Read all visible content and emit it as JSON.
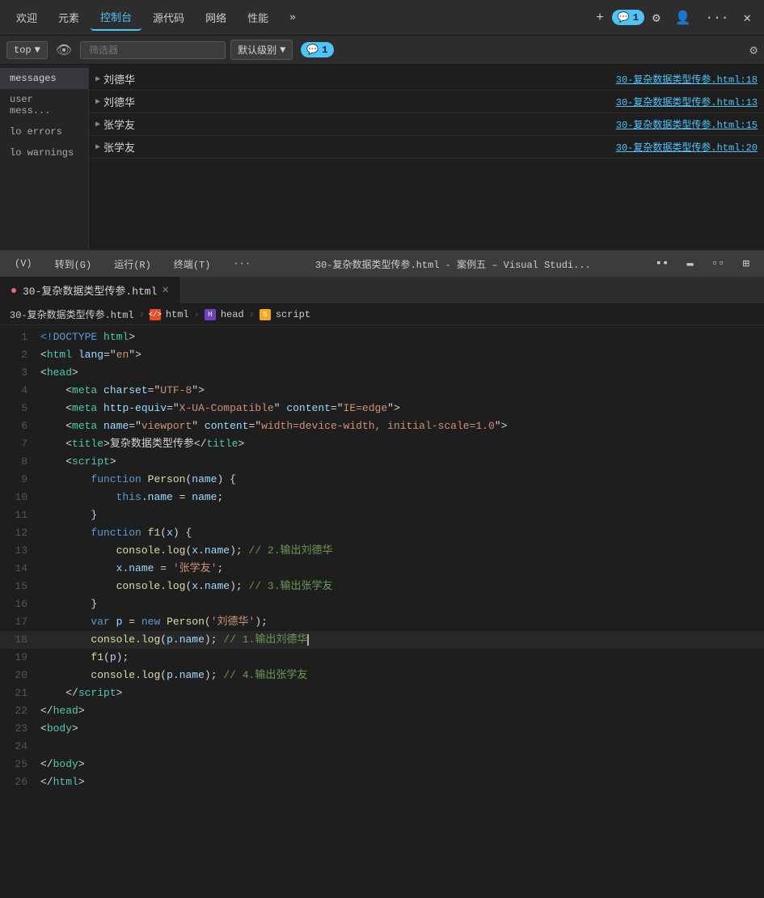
{
  "nav": {
    "tabs": [
      {
        "id": "welcome",
        "label": "欢迎"
      },
      {
        "id": "elements",
        "label": "元素"
      },
      {
        "id": "console",
        "label": "控制台"
      },
      {
        "id": "sources",
        "label": "源代码"
      },
      {
        "id": "network",
        "label": "网络"
      },
      {
        "id": "performance",
        "label": "性能"
      }
    ],
    "more_label": "»",
    "add_label": "+",
    "badge_count": "1",
    "settings_icon": "⚙",
    "profile_icon": "👤",
    "more_icon": "···",
    "close_icon": "✕"
  },
  "console_toolbar": {
    "top_label": "top",
    "dropdown_arrow": "▼",
    "eye_icon": "👁",
    "filter_placeholder": "筛选器",
    "level_label": "默认级别",
    "badge_count": "1",
    "settings_icon": "⚙"
  },
  "sidebar": {
    "items": [
      {
        "id": "messages",
        "label": "messages",
        "active": true
      },
      {
        "id": "user-messages",
        "label": "user mess..."
      },
      {
        "id": "errors",
        "label": "lo errors"
      },
      {
        "id": "warnings",
        "label": "lo warnings"
      }
    ]
  },
  "console_rows": [
    {
      "text": "刘德华",
      "link": "30-复杂数据类型传参.html:18"
    },
    {
      "text": "刘德华",
      "link": "30-复杂数据类型传参.html:13"
    },
    {
      "text": "张学友",
      "link": "30-复杂数据类型传参.html:15"
    },
    {
      "text": "张学友",
      "link": "30-复杂数据类型传参.html:20"
    }
  ],
  "vscode": {
    "title_bar": {
      "menu_items": [
        "(V)",
        "转到(G)",
        "运行(R)",
        "终端(T)",
        "···"
      ],
      "center_title": "30-复杂数据类型传参.html - 案例五 – Visual Studi...",
      "icons": [
        "▪▪",
        "▬",
        "▫▫",
        "⊞"
      ]
    },
    "file_tab": {
      "filename": "30-复杂数据类型传参.html",
      "close": "✕"
    },
    "breadcrumb": {
      "file": "30-复杂数据类型传参.html",
      "sep1": "›",
      "html_label": "html",
      "sep2": "›",
      "head_label": "head",
      "sep3": "›",
      "script_label": "script"
    },
    "code_lines": [
      {
        "num": 1,
        "tokens": [
          {
            "t": "kw",
            "v": "<!DOCTYPE"
          },
          {
            "t": "white",
            "v": " "
          },
          {
            "t": "tag",
            "v": "html"
          },
          {
            "t": "white",
            "v": ">"
          }
        ]
      },
      {
        "num": 2,
        "tokens": [
          {
            "t": "white",
            "v": "<"
          },
          {
            "t": "tag",
            "v": "html"
          },
          {
            "t": "white",
            "v": " "
          },
          {
            "t": "attr",
            "v": "lang"
          },
          {
            "t": "white",
            "v": "=\""
          },
          {
            "t": "val",
            "v": "en"
          },
          {
            "t": "white",
            "v": "\">"
          }
        ]
      },
      {
        "num": 3,
        "tokens": [
          {
            "t": "white",
            "v": "<"
          },
          {
            "t": "cyan",
            "v": "head"
          },
          {
            "t": "white",
            "v": ">"
          }
        ]
      },
      {
        "num": 4,
        "tokens": [
          {
            "t": "white",
            "v": "    <"
          },
          {
            "t": "tag",
            "v": "meta"
          },
          {
            "t": "white",
            "v": " "
          },
          {
            "t": "attr",
            "v": "charset"
          },
          {
            "t": "white",
            "v": "=\""
          },
          {
            "t": "val",
            "v": "UTF-8"
          },
          {
            "t": "white",
            "v": "\">"
          }
        ]
      },
      {
        "num": 5,
        "tokens": [
          {
            "t": "white",
            "v": "    <"
          },
          {
            "t": "tag",
            "v": "meta"
          },
          {
            "t": "white",
            "v": " "
          },
          {
            "t": "attr",
            "v": "http-equiv"
          },
          {
            "t": "white",
            "v": "=\""
          },
          {
            "t": "val",
            "v": "X-UA-Compatible"
          },
          {
            "t": "white",
            "v": "\" "
          },
          {
            "t": "attr",
            "v": "content"
          },
          {
            "t": "white",
            "v": "=\""
          },
          {
            "t": "val",
            "v": "IE=edge"
          },
          {
            "t": "white",
            "v": "\">"
          }
        ]
      },
      {
        "num": 6,
        "tokens": [
          {
            "t": "white",
            "v": "    <"
          },
          {
            "t": "tag",
            "v": "meta"
          },
          {
            "t": "white",
            "v": " "
          },
          {
            "t": "attr",
            "v": "name"
          },
          {
            "t": "white",
            "v": "=\""
          },
          {
            "t": "val",
            "v": "viewport"
          },
          {
            "t": "white",
            "v": "\" "
          },
          {
            "t": "attr",
            "v": "content"
          },
          {
            "t": "white",
            "v": "=\""
          },
          {
            "t": "val",
            "v": "width=device-width, initial-scale=1.0"
          },
          {
            "t": "white",
            "v": "\">"
          }
        ]
      },
      {
        "num": 7,
        "tokens": [
          {
            "t": "white",
            "v": "    <"
          },
          {
            "t": "tag",
            "v": "title"
          },
          {
            "t": "white",
            "v": ">复杂数据类型传参</"
          },
          {
            "t": "tag",
            "v": "title"
          },
          {
            "t": "white",
            "v": ">"
          }
        ]
      },
      {
        "num": 8,
        "tokens": [
          {
            "t": "white",
            "v": "    <"
          },
          {
            "t": "tag",
            "v": "script"
          },
          {
            "t": "white",
            "v": ">"
          }
        ]
      },
      {
        "num": 9,
        "tokens": [
          {
            "t": "white",
            "v": "        "
          },
          {
            "t": "kw",
            "v": "function"
          },
          {
            "t": "white",
            "v": " "
          },
          {
            "t": "fn-name",
            "v": "Person"
          },
          {
            "t": "white",
            "v": "("
          },
          {
            "t": "param",
            "v": "name"
          },
          {
            "t": "white",
            "v": ") {"
          }
        ]
      },
      {
        "num": 10,
        "tokens": [
          {
            "t": "white",
            "v": "            "
          },
          {
            "t": "kw",
            "v": "this"
          },
          {
            "t": "white",
            "v": "."
          },
          {
            "t": "prop",
            "v": "name"
          },
          {
            "t": "white",
            "v": " = "
          },
          {
            "t": "lt-blue",
            "v": "name"
          },
          {
            "t": "white",
            "v": ";"
          }
        ]
      },
      {
        "num": 11,
        "tokens": [
          {
            "t": "white",
            "v": "        }"
          }
        ]
      },
      {
        "num": 12,
        "tokens": [
          {
            "t": "white",
            "v": "        "
          },
          {
            "t": "kw",
            "v": "function"
          },
          {
            "t": "white",
            "v": " "
          },
          {
            "t": "fn-name",
            "v": "f1"
          },
          {
            "t": "white",
            "v": "("
          },
          {
            "t": "param",
            "v": "x"
          },
          {
            "t": "white",
            "v": ") {"
          }
        ]
      },
      {
        "num": 13,
        "tokens": [
          {
            "t": "white",
            "v": "            "
          },
          {
            "t": "yellow",
            "v": "console"
          },
          {
            "t": "white",
            "v": "."
          },
          {
            "t": "fn-name",
            "v": "log"
          },
          {
            "t": "white",
            "v": "("
          },
          {
            "t": "lt-blue",
            "v": "x"
          },
          {
            "t": "white",
            "v": "."
          },
          {
            "t": "prop",
            "v": "name"
          },
          {
            "t": "white",
            "v": "); "
          },
          {
            "t": "comment",
            "v": "// 2.输出刘德华"
          }
        ]
      },
      {
        "num": 14,
        "tokens": [
          {
            "t": "white",
            "v": "            "
          },
          {
            "t": "lt-blue",
            "v": "x"
          },
          {
            "t": "white",
            "v": "."
          },
          {
            "t": "prop",
            "v": "name"
          },
          {
            "t": "white",
            "v": " = "
          },
          {
            "t": "str",
            "v": "'张学友'"
          },
          {
            "t": "white",
            "v": ";"
          }
        ]
      },
      {
        "num": 15,
        "tokens": [
          {
            "t": "white",
            "v": "            "
          },
          {
            "t": "yellow",
            "v": "console"
          },
          {
            "t": "white",
            "v": "."
          },
          {
            "t": "fn-name",
            "v": "log"
          },
          {
            "t": "white",
            "v": "("
          },
          {
            "t": "lt-blue",
            "v": "x"
          },
          {
            "t": "white",
            "v": "."
          },
          {
            "t": "prop",
            "v": "name"
          },
          {
            "t": "white",
            "v": "); "
          },
          {
            "t": "comment",
            "v": "// 3.输出张学友"
          }
        ]
      },
      {
        "num": 16,
        "tokens": [
          {
            "t": "white",
            "v": "        }"
          }
        ]
      },
      {
        "num": 17,
        "tokens": [
          {
            "t": "white",
            "v": "        "
          },
          {
            "t": "kw",
            "v": "var"
          },
          {
            "t": "white",
            "v": " "
          },
          {
            "t": "lt-blue",
            "v": "p"
          },
          {
            "t": "white",
            "v": " = "
          },
          {
            "t": "kw",
            "v": "new"
          },
          {
            "t": "white",
            "v": " "
          },
          {
            "t": "fn-name",
            "v": "Person"
          },
          {
            "t": "white",
            "v": "("
          },
          {
            "t": "str",
            "v": "'刘德华'"
          },
          {
            "t": "white",
            "v": ");"
          }
        ]
      },
      {
        "num": 18,
        "tokens": [
          {
            "t": "white",
            "v": "        "
          },
          {
            "t": "yellow",
            "v": "console"
          },
          {
            "t": "white",
            "v": "."
          },
          {
            "t": "fn-name",
            "v": "log"
          },
          {
            "t": "white",
            "v": "("
          },
          {
            "t": "lt-blue",
            "v": "p"
          },
          {
            "t": "white",
            "v": "."
          },
          {
            "t": "prop",
            "v": "name"
          },
          {
            "t": "white",
            "v": "); "
          },
          {
            "t": "comment",
            "v": "// 1.输出刘德华"
          },
          {
            "t": "cursor",
            "v": ""
          }
        ],
        "highlighted": true
      },
      {
        "num": 19,
        "tokens": [
          {
            "t": "white",
            "v": "        "
          },
          {
            "t": "fn-name",
            "v": "f1"
          },
          {
            "t": "white",
            "v": "("
          },
          {
            "t": "lt-blue",
            "v": "p"
          },
          {
            "t": "white",
            "v": ");"
          }
        ]
      },
      {
        "num": 20,
        "tokens": [
          {
            "t": "white",
            "v": "        "
          },
          {
            "t": "yellow",
            "v": "console"
          },
          {
            "t": "white",
            "v": "."
          },
          {
            "t": "fn-name",
            "v": "log"
          },
          {
            "t": "white",
            "v": "("
          },
          {
            "t": "lt-blue",
            "v": "p"
          },
          {
            "t": "white",
            "v": "."
          },
          {
            "t": "prop",
            "v": "name"
          },
          {
            "t": "white",
            "v": "); "
          },
          {
            "t": "comment",
            "v": "// 4.输出张学友"
          }
        ]
      },
      {
        "num": 21,
        "tokens": [
          {
            "t": "white",
            "v": "    </"
          },
          {
            "t": "tag",
            "v": "script"
          },
          {
            "t": "white",
            "v": ">"
          }
        ]
      },
      {
        "num": 22,
        "tokens": [
          {
            "t": "white",
            "v": "</"
          },
          {
            "t": "cyan",
            "v": "head"
          },
          {
            "t": "white",
            "v": ">"
          }
        ]
      },
      {
        "num": 23,
        "tokens": [
          {
            "t": "white",
            "v": "<"
          },
          {
            "t": "cyan",
            "v": "body"
          },
          {
            "t": "white",
            "v": ">"
          }
        ]
      },
      {
        "num": 24,
        "tokens": [
          {
            "t": "white",
            "v": ""
          }
        ]
      },
      {
        "num": 25,
        "tokens": [
          {
            "t": "white",
            "v": "</"
          },
          {
            "t": "cyan",
            "v": "body"
          },
          {
            "t": "white",
            "v": ">"
          }
        ]
      },
      {
        "num": 26,
        "tokens": [
          {
            "t": "white",
            "v": "</"
          },
          {
            "t": "cyan",
            "v": "html"
          },
          {
            "t": "white",
            "v": ">"
          }
        ]
      }
    ]
  }
}
